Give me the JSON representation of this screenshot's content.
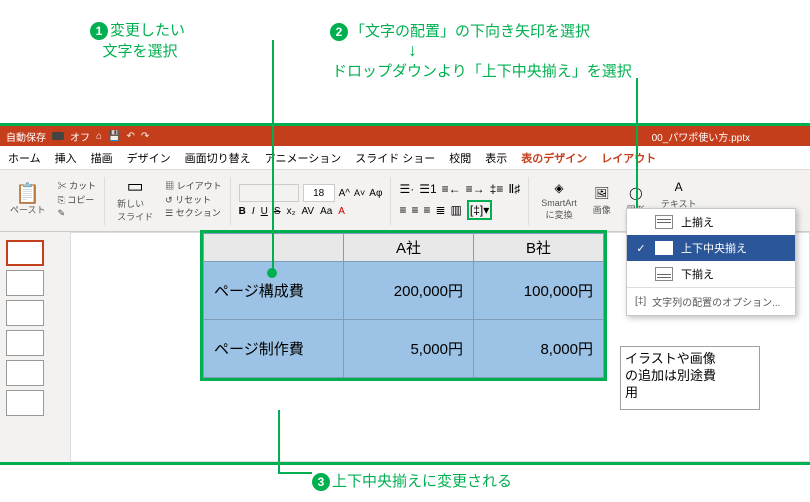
{
  "annotations": {
    "a1_l1": "変更したい",
    "a1_l2": "文字を選択",
    "a2": "「文字の配置」の下向き矢印を選択",
    "a2b": "ドロップダウンより「上下中央揃え」を選択",
    "a3": "上下中央揃えに変更される"
  },
  "titlebar": {
    "autosave": "自動保存",
    "off": "オフ",
    "filename": "00_パワポ使い方.pptx"
  },
  "ribbon": {
    "home": "ホーム",
    "insert": "挿入",
    "draw": "描画",
    "design": "デザイン",
    "trans": "画面切り替え",
    "anim": "アニメーション",
    "slideshow": "スライド ショー",
    "review": "校閲",
    "view": "表示",
    "tabledesign": "表のデザイン",
    "layout": "レイアウト"
  },
  "toolbar": {
    "paste": "ペースト",
    "cut": "カット",
    "copy": "コピー",
    "newslide": "新しい\nスライド",
    "layout": "レイアウト",
    "reset": "リセット",
    "section": "セクション",
    "fontsize": "18",
    "smartart": "SmartArt\nに変換",
    "image": "画像",
    "shape": "図形",
    "textbox": "テキスト\nボックス"
  },
  "table": {
    "h1": "A社",
    "h2": "B社",
    "r1": "ページ構成費",
    "r1a": "200,000円",
    "r1b": "100,000円",
    "r2": "ページ制作費",
    "r2a": "5,000円",
    "r2b": "8,000円"
  },
  "sidebox": {
    "l1": "イラストや画像",
    "l2": "の追加は別途費",
    "l3": "用"
  },
  "dropdown": {
    "top": "上揃え",
    "middle": "上下中央揃え",
    "bottom": "下揃え",
    "opts": "文字列の配置のオプション..."
  }
}
